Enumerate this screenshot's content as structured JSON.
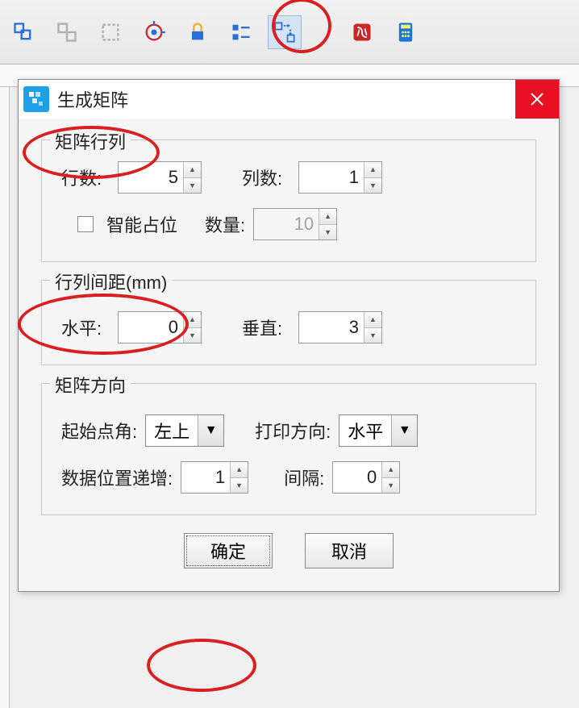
{
  "dialog": {
    "title": "生成矩阵",
    "groups": {
      "rowsCols": {
        "legend": "矩阵行列",
        "rowsLabel": "行数:",
        "rowsValue": "5",
        "colsLabel": "列数:",
        "colsValue": "1",
        "smartLabel": "智能占位",
        "qtyLabel": "数量:",
        "qtyValue": "10"
      },
      "spacing": {
        "legend": "行列间距(mm)",
        "horizLabel": "水平:",
        "horizValue": "0",
        "vertLabel": "垂直:",
        "vertValue": "3"
      },
      "direction": {
        "legend": "矩阵方向",
        "startCornerLabel": "起始点角:",
        "startCornerValue": "左上",
        "printDirLabel": "打印方向:",
        "printDirValue": "水平",
        "dataIncLabel": "数据位置递增:",
        "dataIncValue": "1",
        "gapLabel": "间隔:",
        "gapValue": "0"
      }
    },
    "okButton": "确定",
    "cancelButton": "取消"
  }
}
